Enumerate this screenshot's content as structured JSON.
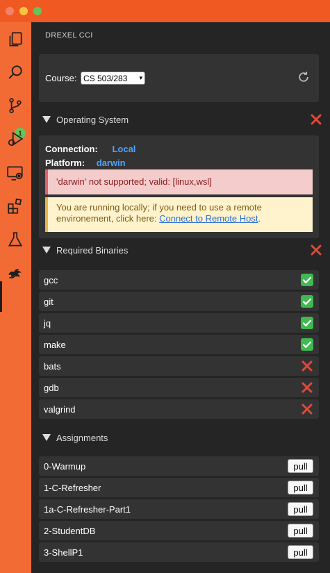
{
  "sidebar": {
    "title": "DREXEL CCI"
  },
  "course": {
    "label": "Course:",
    "selected": "CS 503/283"
  },
  "os_section": {
    "title": "Operating System",
    "connection_label": "Connection:",
    "connection_value": "Local",
    "platform_label": "Platform:",
    "platform_value": "darwin",
    "error_text": "'darwin' not supported; valid: [linux,wsl]",
    "warning_text": "You are running locally; if you need to use a remote environement, click here: ",
    "warning_link": "Connect to Remote Host",
    "warning_suffix": "."
  },
  "binaries_section": {
    "title": "Required Binaries",
    "items": [
      {
        "name": "gcc",
        "ok": true
      },
      {
        "name": "git",
        "ok": true
      },
      {
        "name": "jq",
        "ok": true
      },
      {
        "name": "make",
        "ok": true
      },
      {
        "name": "bats",
        "ok": false
      },
      {
        "name": "gdb",
        "ok": false
      },
      {
        "name": "valgrind",
        "ok": false
      }
    ]
  },
  "assignments_section": {
    "title": "Assignments",
    "pull_label": "pull",
    "items": [
      "0-Warmup",
      "1-C-Refresher",
      "1a-C-Refresher-Part1",
      "2-StudentDB",
      "3-ShellP1"
    ]
  },
  "activity": {
    "source_control_badge": "1"
  },
  "colors": {
    "accent": "#f26b35",
    "link": "#4da3ff",
    "error": "#e04a3a",
    "ok": "#3fb950"
  }
}
